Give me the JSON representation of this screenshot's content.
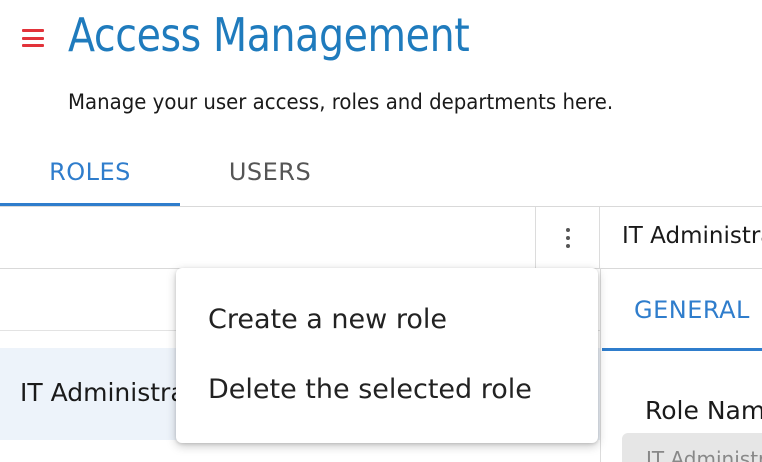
{
  "header": {
    "title": "Access Management",
    "subtitle": "Manage your user access, roles and departments here."
  },
  "tabs": [
    {
      "label": "ROLES",
      "active": true
    },
    {
      "label": "USERS",
      "active": false
    }
  ],
  "roles_list": {
    "items": [
      {
        "label": "IT Administrator",
        "selected": true
      }
    ]
  },
  "detail": {
    "header_name": "IT Administrator",
    "tabs": [
      {
        "label": "GENERAL",
        "active": true
      }
    ],
    "fields": {
      "role_name_label": "Role Name",
      "role_name_value": "IT Administrator"
    }
  },
  "menu": {
    "items": [
      {
        "label": "Create a new role"
      },
      {
        "label": "Delete the selected role"
      }
    ]
  },
  "icons": {
    "menu": "hamburger-menu-icon",
    "more": "more-vertical-icon"
  },
  "colors": {
    "brand": "#1f7bbd",
    "accent": "#2f7dcc",
    "menu_icon": "#e2333a",
    "selected_row": "#edf3fa"
  }
}
